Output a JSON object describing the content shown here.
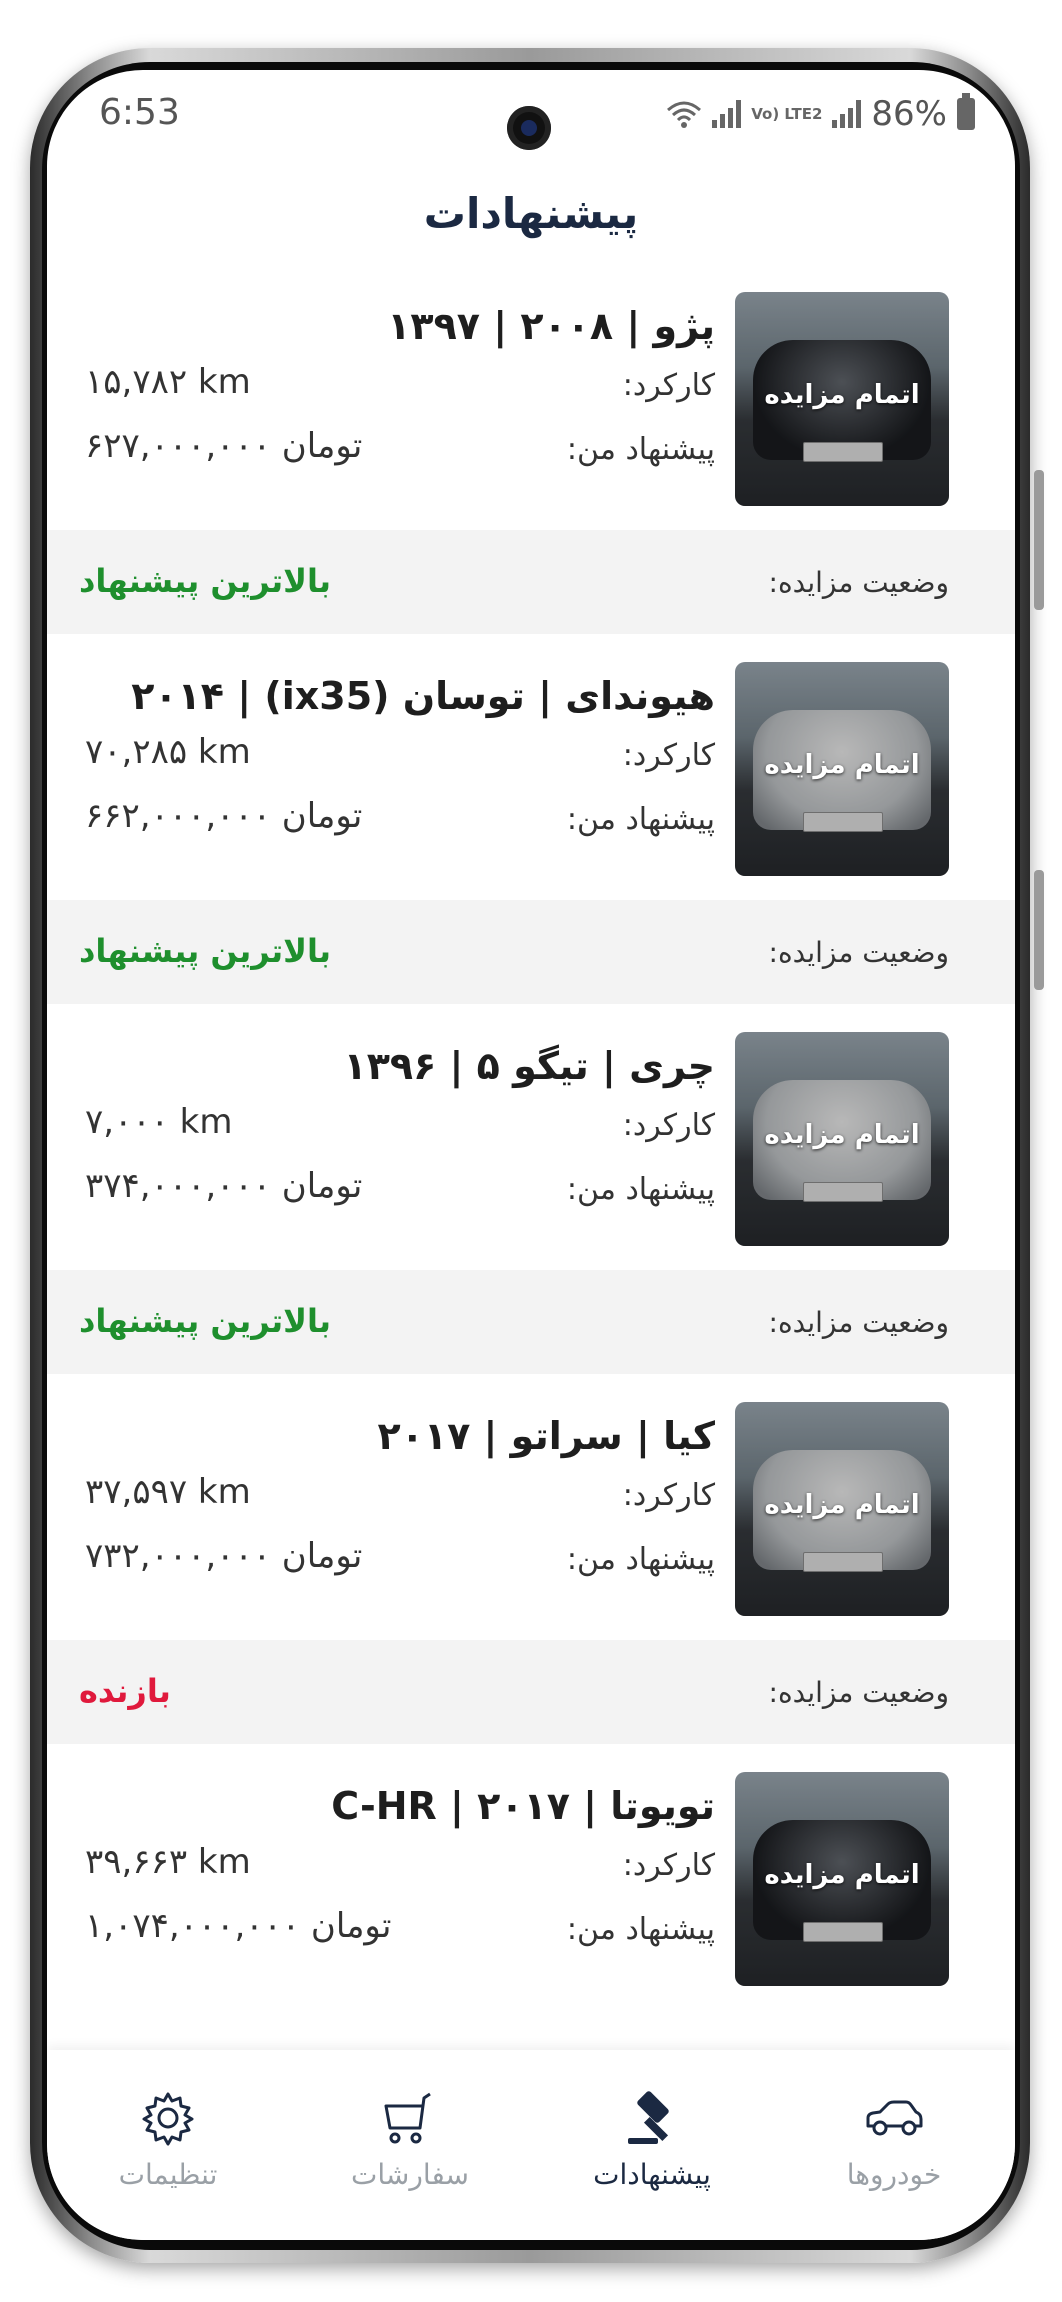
{
  "status_bar": {
    "time": "6:53",
    "network": "Vo) LTE2",
    "battery": "86%"
  },
  "header": {
    "title": "پیشنهادات"
  },
  "cards": [
    {
      "title": "پژو | ۲۰۰۸ | ۱۳۹۷",
      "image_overlay": "اتمام مزایده",
      "mileage_label": "کارکرد:",
      "mileage": "۱۵,۷۸۲ km",
      "offer_label": "پیشنهاد من:",
      "offer": "۶۲۷,۰۰۰,۰۰۰ تومان",
      "status_label": "وضعیت مزایده:",
      "status": "بالاترین پیشنهاد",
      "status_color": "#1e8f2d"
    },
    {
      "title": "هیوندای | توسان (ix35) | ۲۰۱۴",
      "image_overlay": "اتمام مزایده",
      "mileage_label": "کارکرد:",
      "mileage": "۷۰,۲۸۵ km",
      "offer_label": "پیشنهاد من:",
      "offer": "۶۶۲,۰۰۰,۰۰۰ تومان",
      "status_label": "وضعیت مزایده:",
      "status": "بالاترین پیشنهاد",
      "status_color": "#1e8f2d"
    },
    {
      "title": "چری | تیگو ۵ | ۱۳۹۶",
      "image_overlay": "اتمام مزایده",
      "mileage_label": "کارکرد:",
      "mileage": "۷,۰۰۰ km",
      "offer_label": "پیشنهاد من:",
      "offer": "۳۷۴,۰۰۰,۰۰۰ تومان",
      "status_label": "وضعیت مزایده:",
      "status": "بالاترین پیشنهاد",
      "status_color": "#1e8f2d"
    },
    {
      "title": "کیا | سراتو | ۲۰۱۷",
      "image_overlay": "اتمام مزایده",
      "mileage_label": "کارکرد:",
      "mileage": "۳۷,۵۹۷ km",
      "offer_label": "پیشنهاد من:",
      "offer": "۷۳۲,۰۰۰,۰۰۰ تومان",
      "status_label": "وضعیت مزایده:",
      "status": "بازنده",
      "status_color": "#e0193c"
    },
    {
      "title": "تویوتا | C-HR | ۲۰۱۷",
      "image_overlay": "اتمام مزایده",
      "mileage_label": "کارکرد:",
      "mileage": "۳۹,۶۶۳ km",
      "offer_label": "پیشنهاد من:",
      "offer": "۱,۰۷۴,۰۰۰,۰۰۰ تومان"
    }
  ],
  "bottom_nav": {
    "settings": {
      "label": "تنظیمات",
      "icon": "gear-icon"
    },
    "orders": {
      "label": "سفارشات",
      "icon": "cart-icon"
    },
    "offers": {
      "label": "پیشنهادات",
      "icon": "gavel-icon",
      "active": true
    },
    "cars": {
      "label": "خودروها",
      "icon": "car-icon"
    }
  },
  "colors": {
    "accent": "#1b2942",
    "win": "#1e8f2d",
    "lose": "#e0193c",
    "inactive": "#9aa0a6"
  }
}
